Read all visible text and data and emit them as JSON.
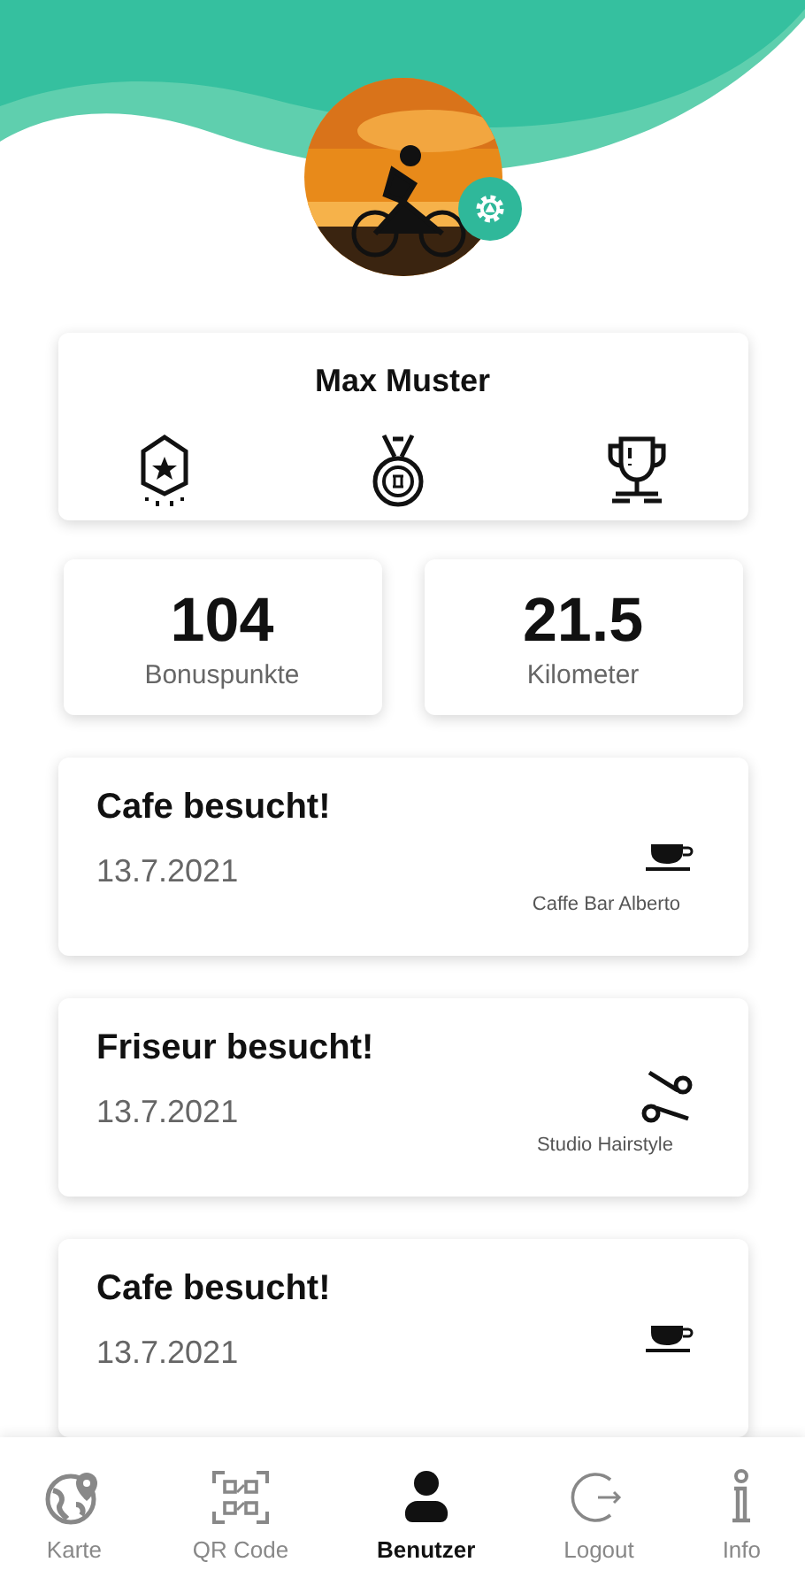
{
  "profile": {
    "name": "Max Muster",
    "badges": [
      {
        "kind": "pennant"
      },
      {
        "kind": "medal"
      },
      {
        "kind": "trophy"
      }
    ]
  },
  "stats": [
    {
      "value": "104",
      "label": "Bonuspunkte"
    },
    {
      "value": "21.5",
      "label": "Kilometer"
    }
  ],
  "events": [
    {
      "title": "Cafe besucht!",
      "date": "13.7.2021",
      "place": "Caffe Bar Alberto",
      "kind": "cafe"
    },
    {
      "title": "Friseur besucht!",
      "date": "13.7.2021",
      "place": "Studio Hairstyle",
      "kind": "scissors"
    },
    {
      "title": "Cafe besucht!",
      "date": "13.7.2021",
      "kind": "cafe"
    }
  ],
  "nav": [
    {
      "label": "Karte",
      "kind": "map",
      "selected": false
    },
    {
      "label": "QR Code",
      "kind": "qr",
      "selected": false
    },
    {
      "label": "Benutzer",
      "kind": "user",
      "selected": true
    },
    {
      "label": "Logout",
      "kind": "logout",
      "selected": false
    },
    {
      "label": "Info",
      "kind": "info",
      "selected": false
    }
  ]
}
